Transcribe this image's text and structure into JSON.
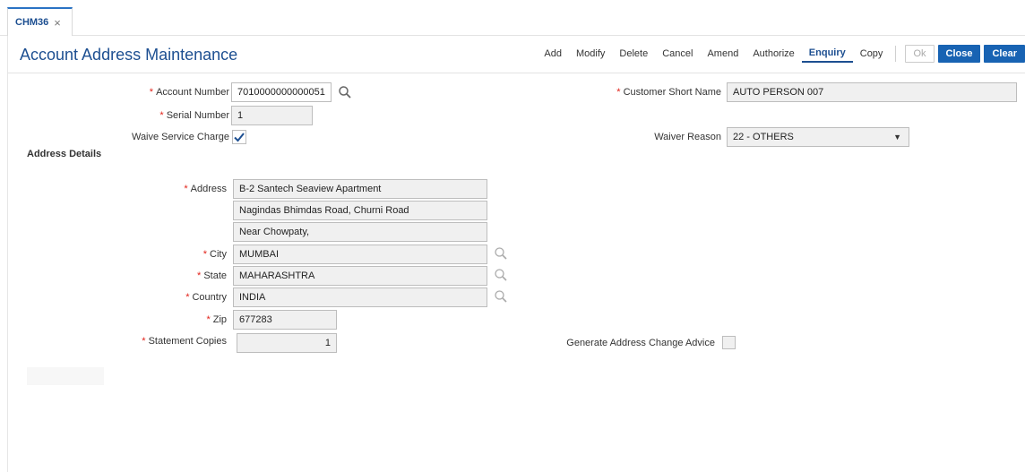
{
  "tab": {
    "label": "CHM36",
    "close": "×"
  },
  "page": {
    "title": "Account Address Maintenance"
  },
  "toolbar": {
    "add": "Add",
    "modify": "Modify",
    "delete": "Delete",
    "cancel": "Cancel",
    "amend": "Amend",
    "authorize": "Authorize",
    "enquiry": "Enquiry",
    "copy": "Copy",
    "ok": "Ok",
    "close": "Close",
    "clear": "Clear"
  },
  "form": {
    "account_number": {
      "label": "Account Number",
      "value": "7010000000000051"
    },
    "customer_short_name": {
      "label": "Customer Short Name",
      "value": "AUTO PERSON 007"
    },
    "serial_number": {
      "label": "Serial Number",
      "value": "1"
    },
    "waive_service_charge": {
      "label": "Waive Service Charge",
      "checked": true
    },
    "waiver_reason": {
      "label": "Waiver Reason",
      "value": "22 - OTHERS"
    }
  },
  "address_details": {
    "title": "Address Details",
    "address_label": "Address",
    "address_lines": [
      "B-2 Santech Seaview Apartment",
      "Nagindas Bhimdas Road, Churni Road",
      "Near Chowpaty,"
    ],
    "city": {
      "label": "City",
      "value": "MUMBAI"
    },
    "state": {
      "label": "State",
      "value": "MAHARASHTRA"
    },
    "country": {
      "label": "Country",
      "value": "INDIA"
    },
    "zip": {
      "label": "Zip",
      "value": "677283"
    },
    "statement_copies": {
      "label": "Statement Copies",
      "value": "1"
    },
    "generate_advice": {
      "label": "Generate Address Change Advice",
      "checked": false
    }
  },
  "colors": {
    "accent": "#1863b3",
    "title": "#1d4f91",
    "required": "#e2231a"
  }
}
